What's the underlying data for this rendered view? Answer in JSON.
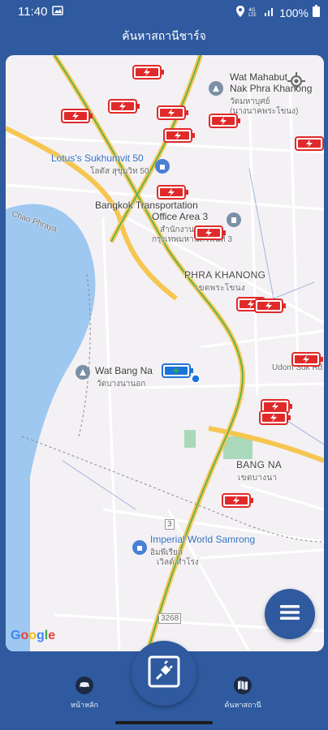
{
  "status_bar": {
    "time": "11:40",
    "battery": "100%",
    "icons": [
      "image-icon",
      "location-icon",
      "data-icon",
      "signal-icon",
      "battery-icon"
    ]
  },
  "app": {
    "title": "ค้นหาสถานีชาร์จ"
  },
  "map": {
    "labels": {
      "wat_mahabut_line1": "Wat Mahabut",
      "wat_mahabut_line2": "Nak Phra Khanong",
      "wat_mahabut_th_1": "วัดมหาบุศย์",
      "wat_mahabut_th_2": "(นางนาคพระโขนง)",
      "lotus": "Lotus's Sukhumvit 50",
      "lotus_th": "โลตัส สุขุมวิท 50",
      "transport_line1": "Bangkok Transportation",
      "transport_line2": "Office Area 3",
      "transport_th_1": "สำนักงานขนส่ง",
      "transport_th_2": "กรุงเทพมหานครพื้นที่ 3",
      "phra_khanong": "PHRA KHANONG",
      "phra_khanong_th": "เขตพระโขนง",
      "wat_bang_na": "Wat Bang Na",
      "wat_bang_na_th": "วัดบางนานอก",
      "bang_na": "BANG NA",
      "bang_na_th": "เขตบางนา",
      "imperial_line1": "Imperial World Samrong",
      "imperial_th_1": "อิมพีเรียล",
      "imperial_th_2": "เวิลด์ สำโรง",
      "river": "Chao Phraya",
      "udom": "Udom Suk Rd",
      "road_3": "3",
      "road_3268": "3268"
    },
    "google": "Google"
  },
  "chargers": {
    "count_red": 15,
    "count_highlighted": 1,
    "colors": {
      "red": "#e02a2a",
      "blue": "#1c74d9",
      "green": "#2fb24a"
    }
  },
  "bottom_nav": {
    "home_label": "หน้าหลัก",
    "search_label": "ค้นหาสถานี"
  },
  "colors": {
    "brand": "#2f5a9f",
    "map_bg": "#f4f1f5",
    "road_major": "#f6c651",
    "road_minor": "#ffffff",
    "water": "#9ec8f0",
    "green_area": "#6cc489"
  }
}
